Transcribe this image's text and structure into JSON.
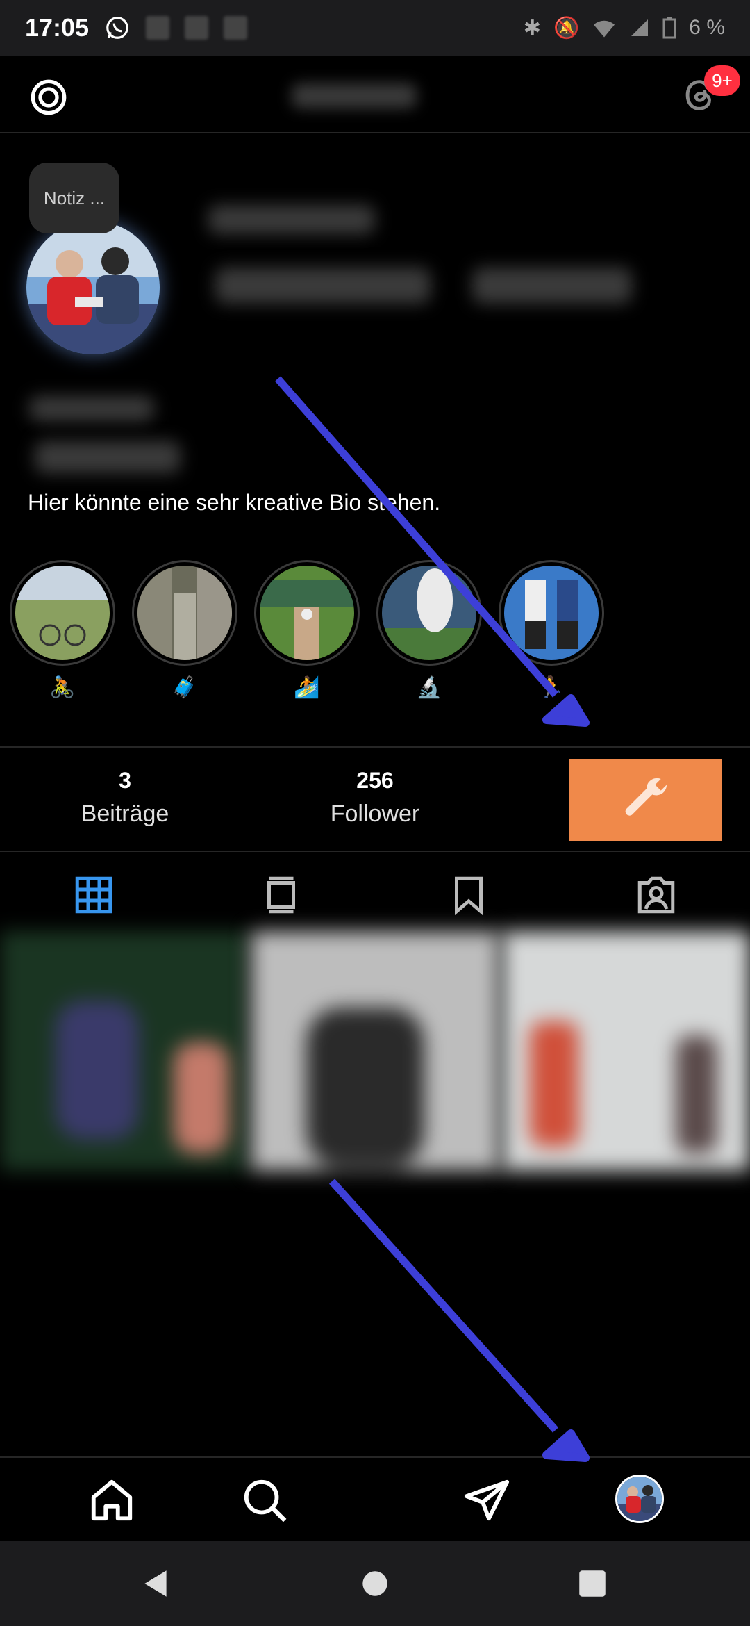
{
  "status_bar": {
    "time": "17:05",
    "battery": "6 %"
  },
  "header": {
    "notification_badge": "9+"
  },
  "profile": {
    "note_placeholder": "Notiz ...",
    "bio": "Hier könnte eine sehr kreative Bio stehen."
  },
  "highlights": [
    {
      "emoji": "🚴"
    },
    {
      "emoji": "🧳"
    },
    {
      "emoji": "🏄"
    },
    {
      "emoji": "🔬"
    },
    {
      "emoji": "🏃"
    }
  ],
  "stats": {
    "posts_count": "3",
    "posts_label": "Beiträge",
    "followers_count": "256",
    "followers_label": "Follower"
  },
  "icons": {
    "settings": "gear-icon",
    "threads": "threads-icon",
    "wrench": "wrench-icon",
    "tabs": [
      "grid-icon",
      "reels-icon",
      "bookmark-icon",
      "tagged-icon"
    ],
    "nav": [
      "home-icon",
      "search-icon",
      "send-icon",
      "profile-avatar"
    ]
  },
  "colors": {
    "accent_orange": "#f0894a",
    "tab_active": "#3897f0",
    "badge_red": "#ff3040",
    "arrow_blue": "#3d3fd8"
  }
}
